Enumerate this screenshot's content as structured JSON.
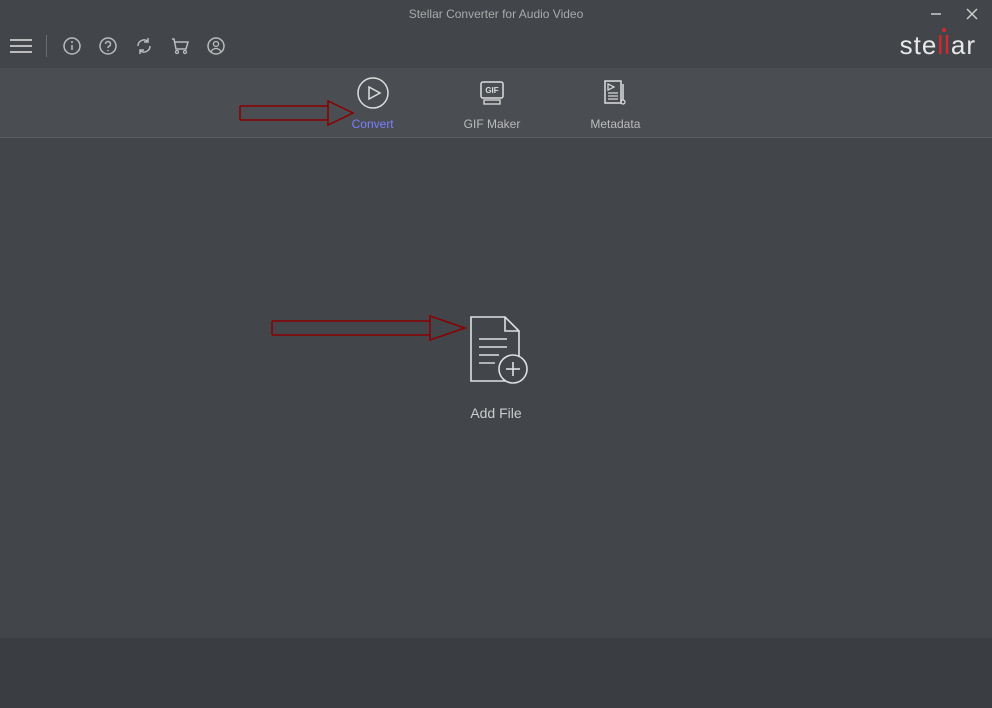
{
  "title": "Stellar Converter for Audio Video",
  "logo": {
    "prefix": "ste",
    "accent": "ll",
    "suffix": "ar"
  },
  "tabs": {
    "convert": "Convert",
    "gif_maker": "GIF Maker",
    "metadata": "Metadata"
  },
  "main": {
    "add_file_label": "Add File"
  }
}
